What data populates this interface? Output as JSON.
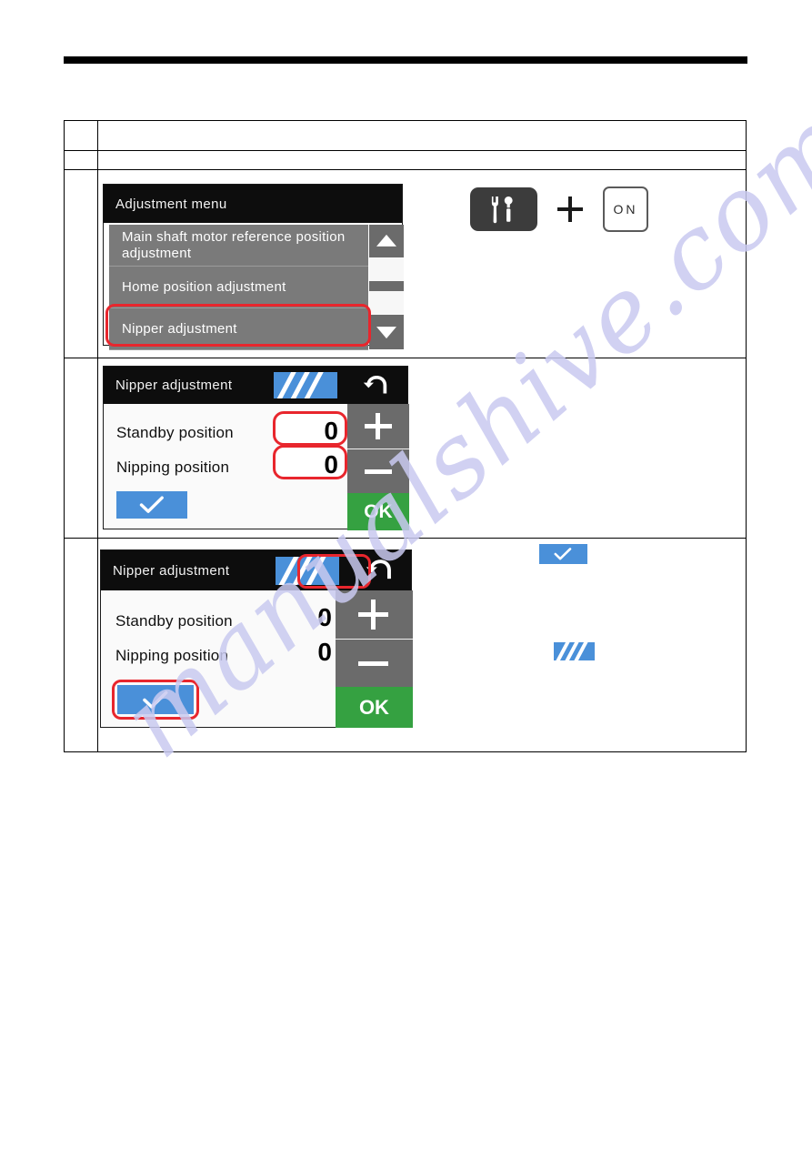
{
  "document": {
    "watermark": "manualshive.com"
  },
  "procedure_table": {
    "rows": [
      {
        "number": "",
        "body": ""
      },
      {
        "number": "",
        "body": ""
      },
      {
        "number": "",
        "body": ""
      },
      {
        "number": "",
        "body": ""
      },
      {
        "number": "",
        "body": ""
      }
    ]
  },
  "step1": {
    "key_combo": {
      "tool_icon": "wrench-screwdriver-icon",
      "separator": "+",
      "power_key_label": "ON"
    },
    "screen": {
      "title": "Adjustment menu",
      "menu_items": [
        "Main shaft motor reference position adjustment",
        "Home position adjustment",
        "Nipper adjustment"
      ],
      "selected_item": "Nipper adjustment",
      "scroll_up_icon": "triangle-up-icon",
      "scroll_down_icon": "triangle-down-icon"
    }
  },
  "step2": {
    "screen": {
      "title": "Nipper adjustment",
      "hatch_icon": "hatch-stripes-icon",
      "back_icon": "undo-arrow-icon",
      "rows": [
        {
          "label": "Standby position",
          "value": "0"
        },
        {
          "label": "Nipping position",
          "value": "0"
        }
      ],
      "confirm_icon": "check-icon",
      "plus_label": "+",
      "minus_label": "−",
      "ok_label": "OK"
    },
    "highlights": [
      "standby-value-box",
      "nipping-value-box"
    ]
  },
  "step3": {
    "screen": {
      "title": "Nipper adjustment",
      "hatch_icon": "hatch-stripes-icon",
      "back_icon": "undo-arrow-icon",
      "rows": [
        {
          "label": "Standby position",
          "value": "0"
        },
        {
          "label": "Nipping position",
          "value": "0"
        }
      ],
      "confirm_icon": "check-icon",
      "plus_label": "+",
      "minus_label": "−",
      "ok_label": "OK"
    },
    "highlights": [
      "hatch-badge-box",
      "check-badge-box"
    ],
    "legend": [
      {
        "icon": "check-icon"
      },
      {
        "icon": "hatch-stripes-icon"
      }
    ]
  },
  "colors": {
    "highlight_red": "#e8262d",
    "badge_blue": "#4a90d9",
    "ok_green": "#35a141",
    "key_gray": "#6b6b6b",
    "menu_gray": "#7a7a7a",
    "header_black": "#0d0d0d",
    "watermark_lavender": "#c9caf0"
  }
}
